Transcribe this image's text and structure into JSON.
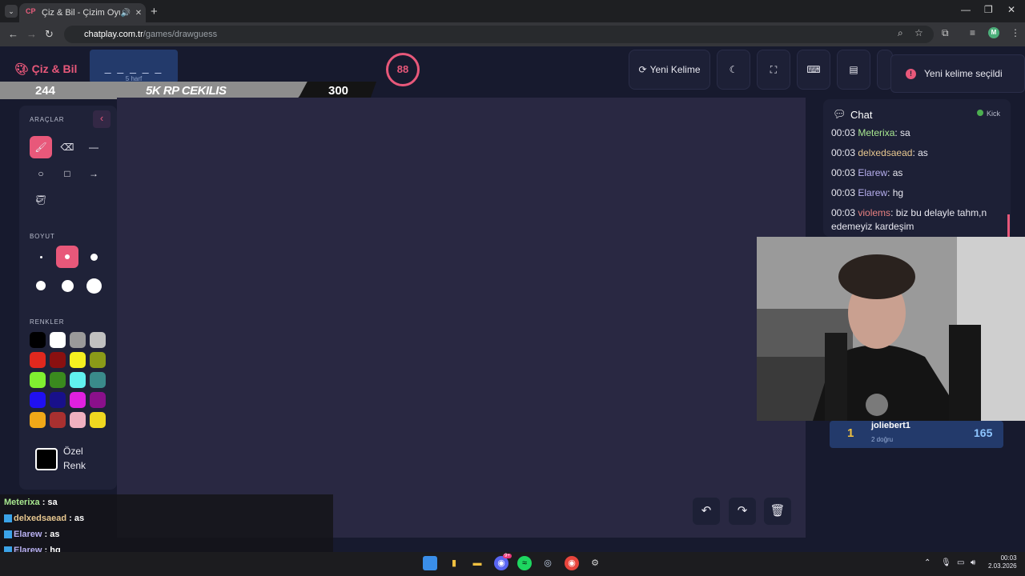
{
  "browser": {
    "tab_title": "Çiz & Bil - Çizim Oyunu",
    "tab_favicon": "CP",
    "url_site": "chatplay.com.tr",
    "url_path": "/games/drawguess",
    "profile_initial": "M"
  },
  "header": {
    "logo": "Çiz & Bil",
    "word_blanks": "_ _ _ _ _",
    "word_count": "5 harf",
    "timer": "88",
    "new_word_label": "Yeni Kelime",
    "toast": "Yeni kelime seçildi",
    "toast_icon": "!"
  },
  "stream_bar": {
    "left_value": "244",
    "title": "5K RP CEKILIS",
    "right_value": "300"
  },
  "tools": {
    "section_tools": "ARAÇLAR",
    "section_size": "BOYUT",
    "section_colors": "RENKLER",
    "custom_color_label": "Özel Renk",
    "colors": [
      "#000000",
      "#ffffff",
      "#9a9a9a",
      "#c0c0c0",
      "#e0281e",
      "#8a1010",
      "#f5f020",
      "#8a9a18",
      "#80f030",
      "#3a8a1e",
      "#60f0f0",
      "#3a8a8a",
      "#2010f0",
      "#18108a",
      "#e020e0",
      "#8a108a",
      "#f0a818",
      "#a83030",
      "#f0b0c0",
      "#f0d820"
    ]
  },
  "chat": {
    "title": "Chat",
    "platform": "Kick",
    "messages": [
      {
        "time": "00:03",
        "user": "Meterixa",
        "text": ": sa",
        "color": "#a8e890"
      },
      {
        "time": "00:03",
        "user": "delxedsaead",
        "text": ": as",
        "color": "#e8c890"
      },
      {
        "time": "00:03",
        "user": "Elarew",
        "text": ": as",
        "color": "#b8b0f0"
      },
      {
        "time": "00:03",
        "user": "Elarew",
        "text": ": hg",
        "color": "#b8b0f0"
      },
      {
        "time": "00:03",
        "user": "violems",
        "text": ": biz bu delayle tahm,n edemeyiz kardeşim",
        "color": "#e88080"
      }
    ]
  },
  "leaderboard": {
    "rank": "1",
    "name": "joliebert1",
    "sub": "2 doğru",
    "score": "165"
  },
  "overlay_chat": [
    {
      "user": "Meterixa",
      "text": " : sa",
      "color": "#a8e890",
      "badge": false
    },
    {
      "user": "delxedsaead",
      "text": " : as",
      "color": "#e8c890",
      "badge": true
    },
    {
      "user": "Elarew",
      "text": " : as",
      "color": "#b8b0f0",
      "badge": true
    },
    {
      "user": "Elarew",
      "text": " : hg",
      "color": "#b8b0f0",
      "badge": true
    },
    {
      "user": "violems",
      "text": " : biz bu delayle tahm,n edemeyiz kardeşim",
      "color": "#e88080",
      "badge": false
    }
  ],
  "taskbar": {
    "time": "00:03",
    "date": "2.03.2026",
    "discord_badge": "9+"
  }
}
